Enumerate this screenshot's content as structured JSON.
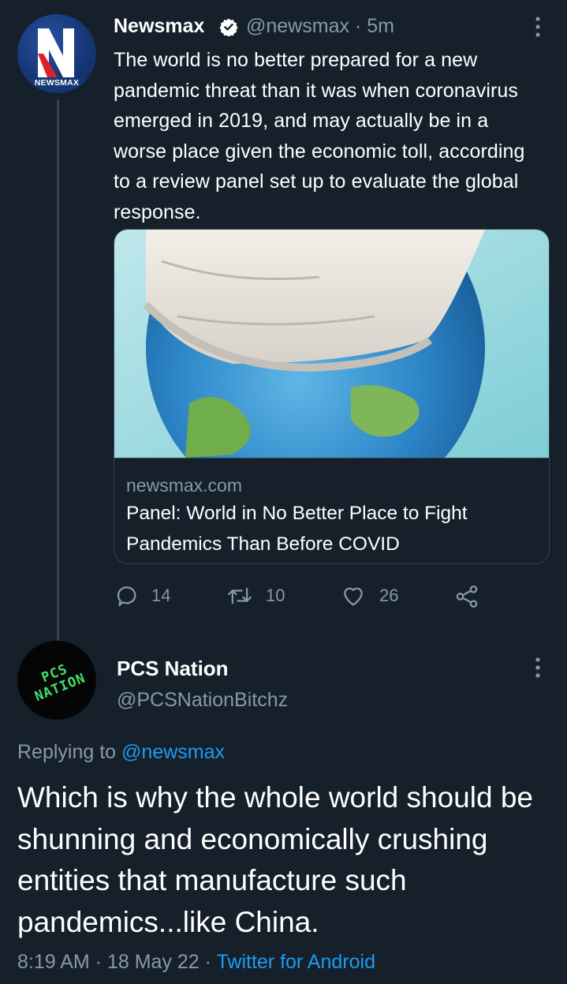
{
  "tweet": {
    "avatar_logo_text": "NEWSMAX",
    "author_name": "Newsmax",
    "handle": "@newsmax",
    "separator": "·",
    "time": "5m",
    "text": "The world is no better prepared for a new pandemic threat than it was when coronavirus emerged in 2019, and may actually be in a worse place given the economic toll, according to a review panel set up to evaluate the global response.",
    "card": {
      "domain": "newsmax.com",
      "title": "Panel: World in No Better Place to Fight Pandemics Than Before COVID"
    },
    "actions": {
      "reply_count": "14",
      "retweet_count": "10",
      "like_count": "26"
    }
  },
  "reply": {
    "avatar_logo_text": "PCS NATION",
    "author_name": "PCS Nation",
    "handle": "@PCSNationBitchz",
    "replying_prefix": "Replying to",
    "replying_to": "@newsmax",
    "text": "Which is why the whole world should be shunning and economically crushing entities that manufacture such pandemics...like China.",
    "time": "8:19 AM",
    "date": "18 May 22",
    "meta_separator": "·",
    "source": "Twitter for Android"
  },
  "icons": {
    "verified": "verified-badge-icon",
    "more": "more-vertical-icon",
    "reply": "reply-bubble-icon",
    "retweet": "retweet-icon",
    "like": "heart-icon",
    "share": "share-icon"
  },
  "colors": {
    "background": "#15202b",
    "secondary_text": "#8899a6",
    "link": "#1d9bf0",
    "border": "#38444d"
  }
}
